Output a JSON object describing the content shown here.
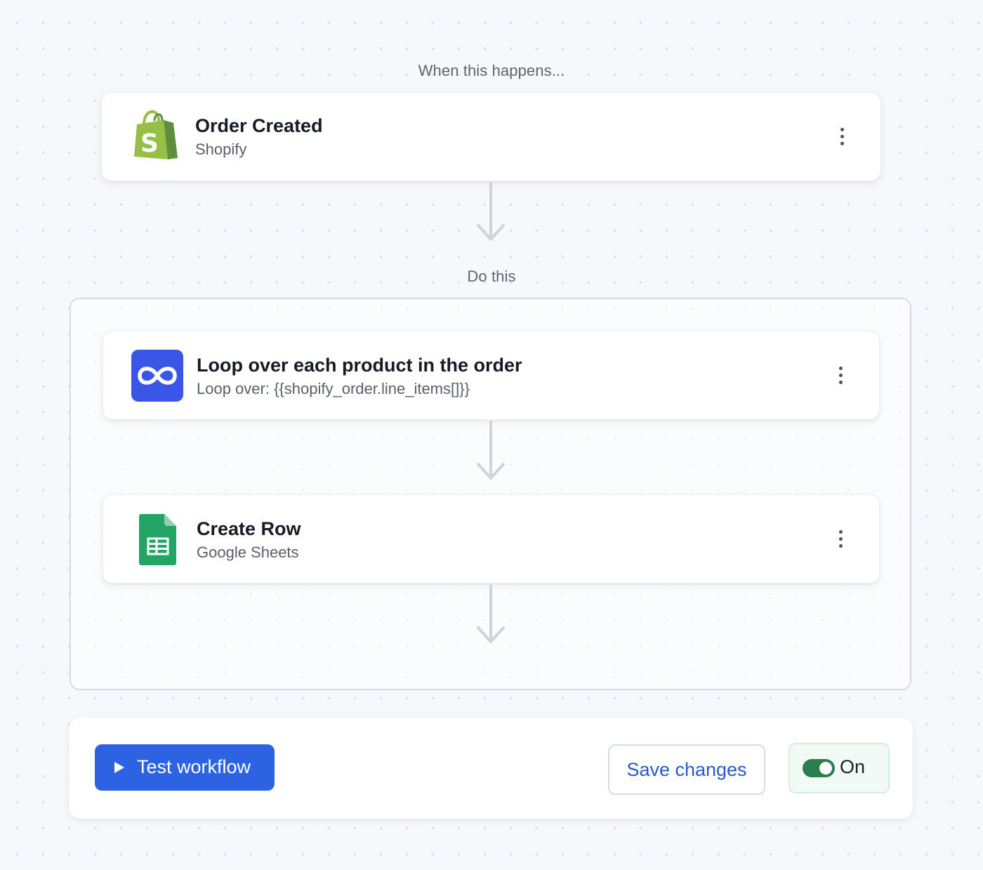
{
  "trigger": {
    "section_label": "When this happens...",
    "title": "Order Created",
    "app": "Shopify",
    "icon": "shopify-bag-icon",
    "brand_color": "#95bf47"
  },
  "actions": {
    "section_label": "Do this",
    "steps": [
      {
        "title": "Loop over each product in the order",
        "subtitle": "Loop over: {{shopify_order.line_items[]}}",
        "icon": "loop-infinity-icon",
        "color": "#3b55e6"
      },
      {
        "title": "Create Row",
        "subtitle": "Google Sheets",
        "icon": "google-sheets-icon",
        "color": "#23a566"
      }
    ]
  },
  "footer": {
    "test_label": "Test workflow",
    "save_label": "Save changes",
    "toggle_label": "On",
    "toggle_on": true,
    "accent": "#2d63e2",
    "toggle_color": "#2e7d4d"
  }
}
